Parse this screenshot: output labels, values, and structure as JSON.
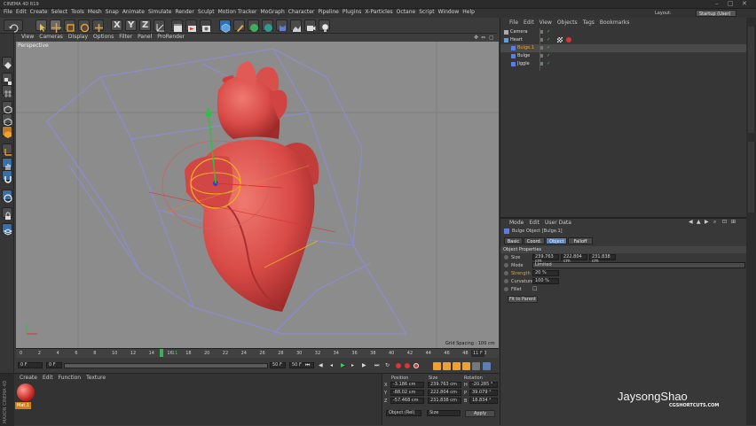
{
  "app": {
    "title": "CINEMA 4D R19"
  },
  "window": {
    "layout_label": "Layout:",
    "layout_value": "Startup (User)"
  },
  "menu": [
    "File",
    "Edit",
    "Create",
    "Select",
    "Tools",
    "Mesh",
    "Snap",
    "Animate",
    "Simulate",
    "Render",
    "Sculpt",
    "Motion Tracker",
    "MoGraph",
    "Character",
    "Pipeline",
    "Plugins",
    "X-Particles",
    "Octane",
    "Script",
    "Window",
    "Help"
  ],
  "viewport": {
    "menu": [
      "View",
      "Cameras",
      "Display",
      "Options",
      "Filter",
      "Panel",
      "ProRender"
    ],
    "label": "Perspective",
    "grid_spacing": "Grid Spacing : 100 cm"
  },
  "timeline": {
    "ticks": [
      "0",
      "2",
      "4",
      "6",
      "8",
      "10",
      "12",
      "14",
      "16",
      "18",
      "20",
      "22",
      "24",
      "26",
      "28",
      "30",
      "32",
      "34",
      "36",
      "38",
      "40",
      "42",
      "44",
      "46",
      "48",
      "50"
    ],
    "current_frame_label": "11",
    "frame_marker": "11 F",
    "start_field": "0 F",
    "start_field2": "0 F",
    "end_field": "50 F",
    "end_field2": "50 F"
  },
  "material_manager": {
    "menu": [
      "Create",
      "Edit",
      "Function",
      "Texture"
    ],
    "material_name": "Mat.1",
    "brand": "MAXON CINEMA 4D"
  },
  "coordinates": {
    "headers": [
      "Position",
      "Size",
      "Rotation"
    ],
    "rows": [
      {
        "axis": "X",
        "pos": "-3.186 cm",
        "size": "239.763 cm",
        "rot_axis": "H",
        "rot": "-20.285 °"
      },
      {
        "axis": "Y",
        "pos": "-88.02 cm",
        "size": "222.804 cm",
        "rot_axis": "P",
        "rot": "39.079 °"
      },
      {
        "axis": "Z",
        "pos": "-57.468 cm",
        "size": "231.838 cm",
        "rot_axis": "B",
        "rot": "18.834 °"
      }
    ],
    "mode_select": "Object (Rel)",
    "size_select": "Size",
    "apply": "Apply"
  },
  "object_manager": {
    "menu": [
      "File",
      "Edit",
      "View",
      "Objects",
      "Tags",
      "Bookmarks"
    ],
    "objects": [
      {
        "name": "Camera",
        "indent": 0,
        "selected": false
      },
      {
        "name": "Heart",
        "indent": 0,
        "selected": false
      },
      {
        "name": "Bulge.1",
        "indent": 1,
        "selected": true
      },
      {
        "name": "Bulge",
        "indent": 1,
        "selected": false
      },
      {
        "name": "Jiggle",
        "indent": 1,
        "selected": false
      }
    ]
  },
  "attribute_manager": {
    "menu": [
      "Mode",
      "Edit",
      "User Data"
    ],
    "object_title": "Bulge Object [Bulge.1]",
    "tabs": [
      "Basic",
      "Coord.",
      "Object",
      "Falloff"
    ],
    "active_tab": "Object",
    "section": "Object Properties",
    "props": [
      {
        "label": "Size",
        "value": "239.763 cm",
        "value2": "222.804 cm",
        "value3": "231.838 cm"
      },
      {
        "label": "Mode",
        "value": "Limited"
      },
      {
        "label": "Strength",
        "value": "20 %"
      },
      {
        "label": "Curvature",
        "value": "100 %"
      },
      {
        "label": "Fillet",
        "value": "☐"
      }
    ],
    "fit_button": "Fit to Parent"
  },
  "watermark": {
    "name": "JaysongShao",
    "site": "CGSHORTCUTS.COM"
  },
  "colors": {
    "accent": "#f29a2e",
    "heart": "#d94444",
    "selection": "#f0a020",
    "viewport_bg": "#8c8c8c"
  }
}
